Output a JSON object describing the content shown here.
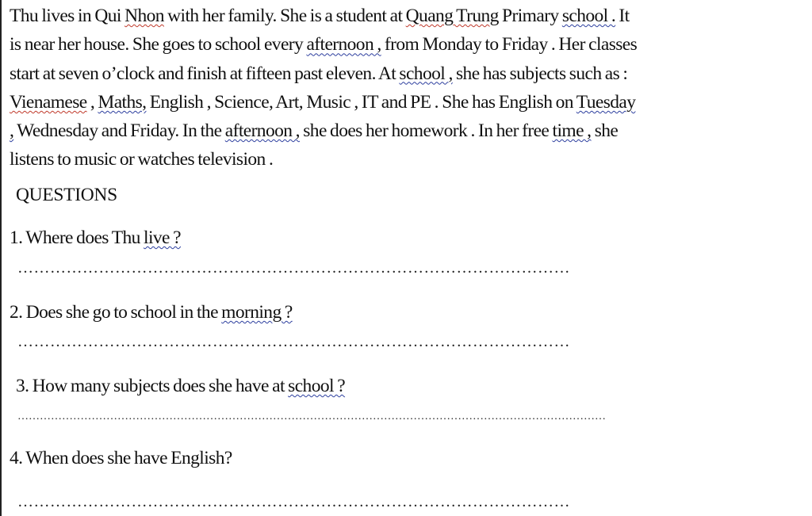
{
  "passage": {
    "lines": [
      [
        {
          "t": "Thu lives in Qui "
        },
        {
          "t": "Nhon",
          "u": "sq"
        },
        {
          "t": " with her family. She is a student at "
        },
        {
          "t": "Quang Trung",
          "u": "sq"
        },
        {
          "t": " Primary "
        },
        {
          "t": "school .",
          "u": "sqb"
        },
        {
          "t": " It"
        }
      ],
      [
        {
          "t": "is near her house. She goes to school every "
        },
        {
          "t": "afternoon ,",
          "u": "sqb"
        },
        {
          "t": " from Monday to Friday . Her classes"
        }
      ],
      [
        {
          "t": "start at seven o’clock and finish at fifteen past eleven. At "
        },
        {
          "t": "school ,",
          "u": "sqb"
        },
        {
          "t": " she has subjects such as :"
        }
      ],
      [
        {
          "t": "Vienamese",
          "u": "sq"
        },
        {
          "t": " , "
        },
        {
          "t": "Maths,",
          "u": "sqb"
        },
        {
          "t": "  English , Science, Art, Music , IT and PE .  She has English on "
        },
        {
          "t": "Tuesday",
          "u": "sqb"
        }
      ],
      [
        {
          "t": ",",
          "u": "sqb"
        },
        {
          "t": " Wednesday and Friday. In the "
        },
        {
          "t": "afternoon ,",
          "u": "sqb"
        },
        {
          "t": " she does her homework . In her free "
        },
        {
          "t": "time ,",
          "u": "sqb"
        },
        {
          "t": " she"
        }
      ],
      [
        {
          "t": "listens to music or watches television ."
        }
      ]
    ]
  },
  "heading": "QUESTIONS",
  "questions": [
    {
      "pre": "1. Where does Thu ",
      "u": "live ?",
      "post": "",
      "dots": "…………………………………………………………………………………………"
    },
    {
      "pre": "2. Does she go to school in the ",
      "u": "morning ?",
      "post": "",
      "dots": "…………………………………………………………………………………………"
    },
    {
      "pre": "3. How many subjects does she have at ",
      "u": "school ?",
      "post": "",
      "dots": "……………………………………………………………………………………………………………………………………………"
    },
    {
      "pre": "4. When does she have English?",
      "u": "",
      "post": "",
      "dots": "…………………………………………………………………………………………"
    }
  ]
}
